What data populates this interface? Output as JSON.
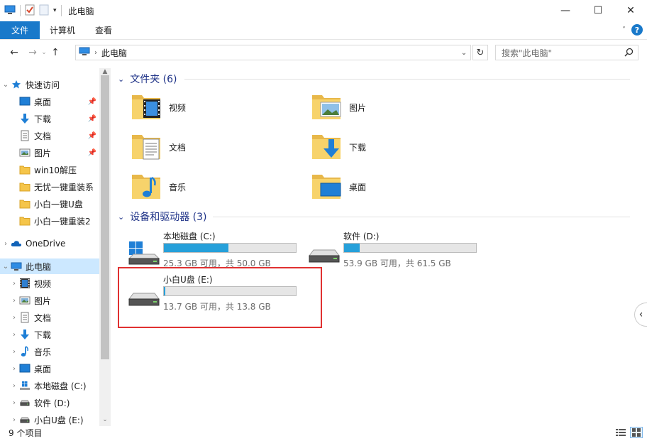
{
  "window": {
    "title": "此电脑",
    "minimize": "—",
    "maximize": "☐",
    "close": "✕"
  },
  "ribbon": {
    "tabs": [
      "文件",
      "计算机",
      "查看"
    ]
  },
  "address": {
    "path": "此电脑",
    "search_placeholder": "搜索\"此电脑\""
  },
  "nav": {
    "quick_access": "快速访问",
    "quick_items": [
      {
        "label": "桌面",
        "icon": "desktop-icon",
        "pinned": true
      },
      {
        "label": "下载",
        "icon": "download-icon",
        "pinned": true
      },
      {
        "label": "文档",
        "icon": "document-icon",
        "pinned": true
      },
      {
        "label": "图片",
        "icon": "picture-icon",
        "pinned": true
      },
      {
        "label": "win10解压",
        "icon": "folder-icon",
        "pinned": false
      },
      {
        "label": "无忧一键重装系",
        "icon": "folder-icon",
        "pinned": false
      },
      {
        "label": "小白一键U盘",
        "icon": "folder-icon",
        "pinned": false
      },
      {
        "label": "小白一键重装2",
        "icon": "folder-icon",
        "pinned": false
      }
    ],
    "onedrive": "OneDrive",
    "this_pc": "此电脑",
    "pc_items": [
      {
        "label": "视频",
        "icon": "video-icon"
      },
      {
        "label": "图片",
        "icon": "picture-icon"
      },
      {
        "label": "文档",
        "icon": "document-icon"
      },
      {
        "label": "下载",
        "icon": "download-icon"
      },
      {
        "label": "音乐",
        "icon": "music-icon"
      },
      {
        "label": "桌面",
        "icon": "desktop-icon"
      },
      {
        "label": "本地磁盘 (C:)",
        "icon": "windows-drive-icon"
      },
      {
        "label": "软件 (D:)",
        "icon": "drive-icon"
      },
      {
        "label": "小白U盘 (E:)",
        "icon": "drive-icon"
      }
    ]
  },
  "content": {
    "folders_header": "文件夹 (6)",
    "folders": [
      {
        "name": "视频",
        "icon": "video-folder-icon"
      },
      {
        "name": "图片",
        "icon": "picture-folder-icon"
      },
      {
        "name": "文档",
        "icon": "document-folder-icon"
      },
      {
        "name": "下载",
        "icon": "download-folder-icon"
      },
      {
        "name": "音乐",
        "icon": "music-folder-icon"
      },
      {
        "name": "桌面",
        "icon": "desktop-folder-icon"
      }
    ],
    "drives_header": "设备和驱动器 (3)",
    "drives": [
      {
        "name": "本地磁盘 (C:)",
        "info": "25.3 GB 可用，共 50.0 GB",
        "used_fraction": 0.49,
        "icon": "windows-drive-icon"
      },
      {
        "name": "软件 (D:)",
        "info": "53.9 GB 可用，共 61.5 GB",
        "used_fraction": 0.12,
        "icon": "drive-icon"
      },
      {
        "name": "小白U盘 (E:)",
        "info": "13.7 GB 可用，共 13.8 GB",
        "used_fraction": 0.01,
        "icon": "drive-icon"
      }
    ]
  },
  "status": {
    "count": "9 个项目"
  },
  "colors": {
    "accent": "#1979ca",
    "bar_fill": "#26a0da",
    "highlight_box": "#e03131",
    "selected": "#cce8ff",
    "group_header": "#1e3287"
  }
}
